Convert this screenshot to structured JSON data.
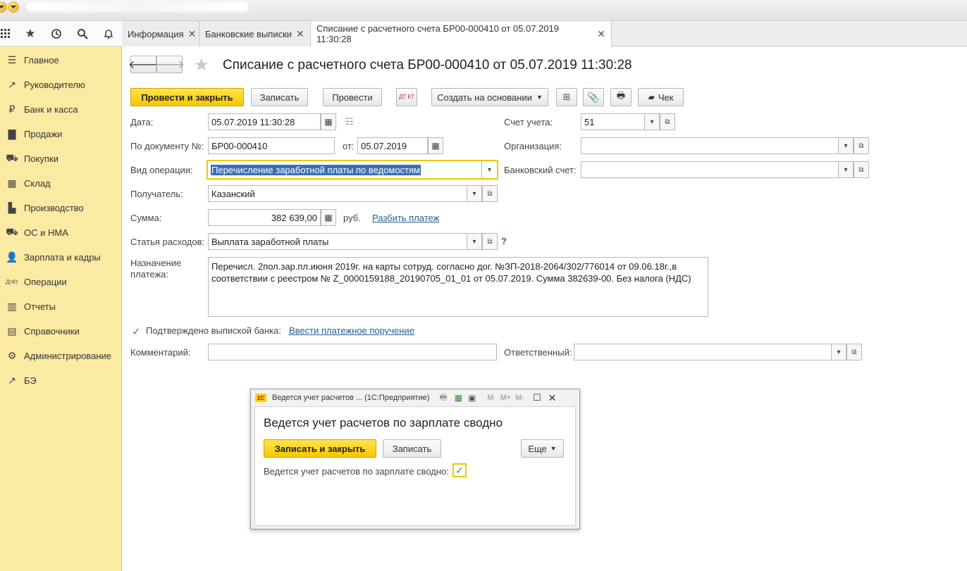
{
  "toolbar": {
    "icons": [
      "apps-grid-icon",
      "star-icon",
      "history-icon",
      "search-icon",
      "bell-icon"
    ]
  },
  "tabs": [
    {
      "label": "Информация"
    },
    {
      "label": "Банковские выписки"
    },
    {
      "label": "Списание с расчетного счета БР00-000410 от 05.07.2019 11:30:28"
    }
  ],
  "sidebar": {
    "items": [
      {
        "label": "Главное",
        "icon": "menu-lines-icon"
      },
      {
        "label": "Руководителю",
        "icon": "trend-icon"
      },
      {
        "label": "Банк и касса",
        "icon": "ruble-icon"
      },
      {
        "label": "Продажи",
        "icon": "bag-icon"
      },
      {
        "label": "Покупки",
        "icon": "cart-icon"
      },
      {
        "label": "Склад",
        "icon": "grid-icon"
      },
      {
        "label": "Производство",
        "icon": "factory-icon"
      },
      {
        "label": "ОС и НМА",
        "icon": "truck-icon"
      },
      {
        "label": "Зарплата и кадры",
        "icon": "person-icon"
      },
      {
        "label": "Операции",
        "icon": "dt-kt-icon"
      },
      {
        "label": "Отчеты",
        "icon": "bar-chart-icon"
      },
      {
        "label": "Справочники",
        "icon": "book-icon"
      },
      {
        "label": "Администрирование",
        "icon": "gear-icon"
      },
      {
        "label": "БЭ",
        "icon": "trend-icon"
      }
    ]
  },
  "document": {
    "title": "Списание с расчетного счета БР00-000410 от 05.07.2019 11:30:28",
    "buttons": {
      "post_close": "Провести и закрыть",
      "save": "Записать",
      "post": "Провести",
      "dtkt": "ДТ КТ",
      "create_based": "Создать на основании",
      "check": "Чек"
    },
    "fields": {
      "date_label": "Дата:",
      "date_value": "05.07.2019 11:30:28",
      "doc_num_label": "По документу №:",
      "doc_num_value": "БР00-000410",
      "from_label": "от:",
      "from_value": "05.07.2019",
      "operation_label": "Вид операции:",
      "operation_value": "Перечисление заработной платы по ведомостям",
      "recipient_label": "Получатель:",
      "recipient_value": "Казанский",
      "sum_label": "Сумма:",
      "sum_value": "382 639,00",
      "currency": "руб.",
      "split_link": "Разбить платеж",
      "expense_label": "Статья расходов:",
      "expense_value": "Выплата заработной платы",
      "help": "?",
      "purpose_label": "Назначение платежа:",
      "purpose_value": "Перечисл. 2пол.зар.пл.июня 2019г. на карты сотруд. согласно дог. №ЗП-2018-2064/302/776014 от 09.06.18г.,в соответствии с реестром № Z_0000159188_20190705_01_01 от 05.07.2019. Сумма 382639-00. Без налога (НДС)",
      "confirmed_label": "Подтверждено выпиской банка:",
      "enter_order_link": "Ввести платежное поручение",
      "comment_label": "Комментарий:",
      "comment_value": "",
      "account_label": "Счет учета:",
      "account_value": "51",
      "org_label": "Организация:",
      "org_value": "",
      "bank_account_label": "Банковский счет:",
      "bank_account_value": "",
      "responsible_label": "Ответственный:",
      "responsible_value": ""
    }
  },
  "modal": {
    "title": "Ведется учет расчетов ...  (1С:Предприятие)",
    "title_buttons": [
      "M",
      "M+",
      "M-"
    ],
    "heading": "Ведется учет расчетов по зарплате сводно",
    "save_close": "Записать и закрыть",
    "save": "Записать",
    "more": "Еще",
    "checkbox_label": "Ведется учет расчетов по зарплате сводно:",
    "checkbox_checked": true
  },
  "colors": {
    "accent_yellow": "#f6c700",
    "sidebar_bg": "#fbeaa1",
    "link": "#2a5d8f",
    "highlight_border": "#f0c800"
  }
}
